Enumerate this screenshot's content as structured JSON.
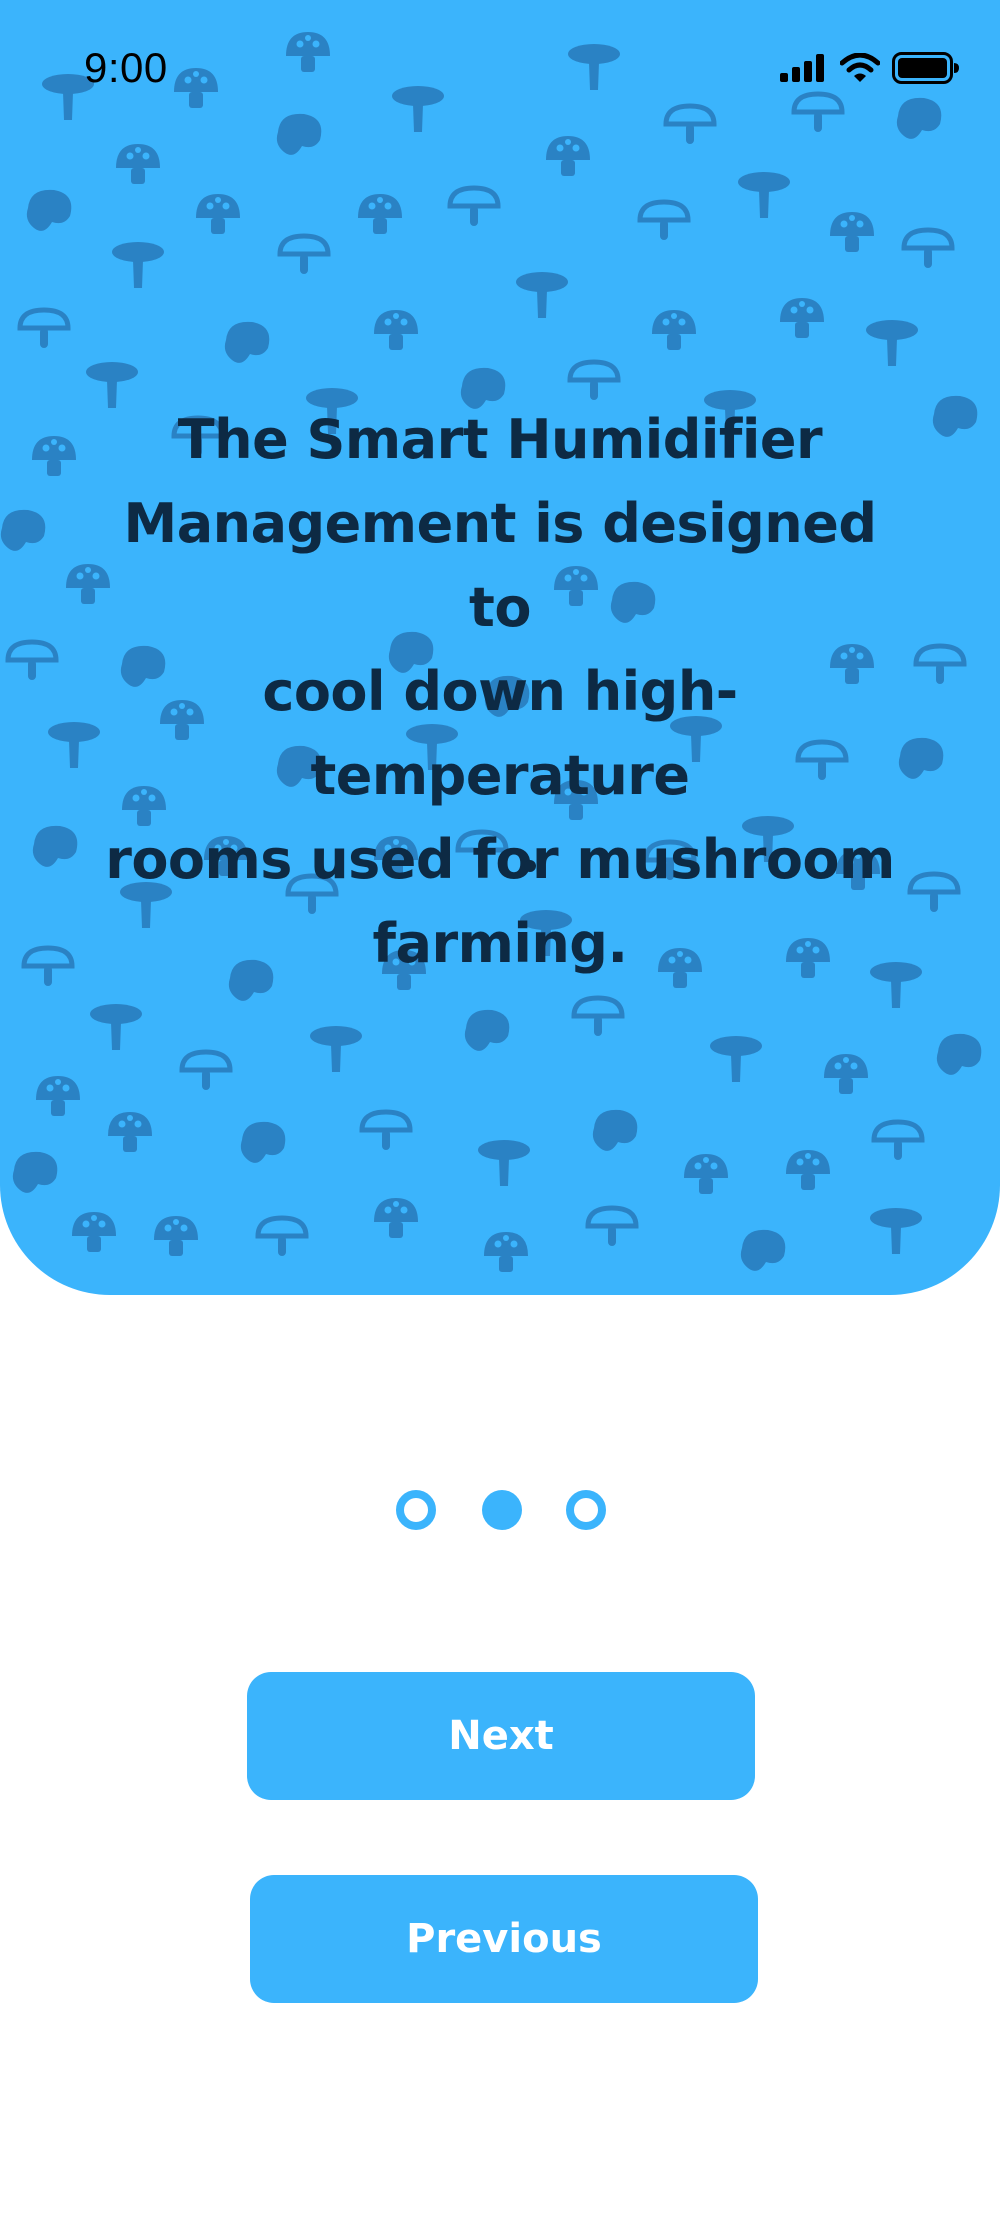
{
  "status_bar": {
    "time": "9:00",
    "icons": [
      "signal-icon",
      "wifi-icon",
      "battery-icon"
    ]
  },
  "hero": {
    "background_color": "#3bb4fc",
    "pattern_icon": "mushroom-icon",
    "text_color": "#0d2a44",
    "description_lines": [
      "The Smart Humidifier",
      "Management is designed to",
      "cool down high-temperature",
      "rooms used for mushroom",
      "farming."
    ],
    "trailing_mark": "."
  },
  "pager": {
    "total": 3,
    "active_index": 1,
    "color": "#3bb4fc"
  },
  "buttons": {
    "next_label": "Next",
    "previous_label": "Previous"
  }
}
